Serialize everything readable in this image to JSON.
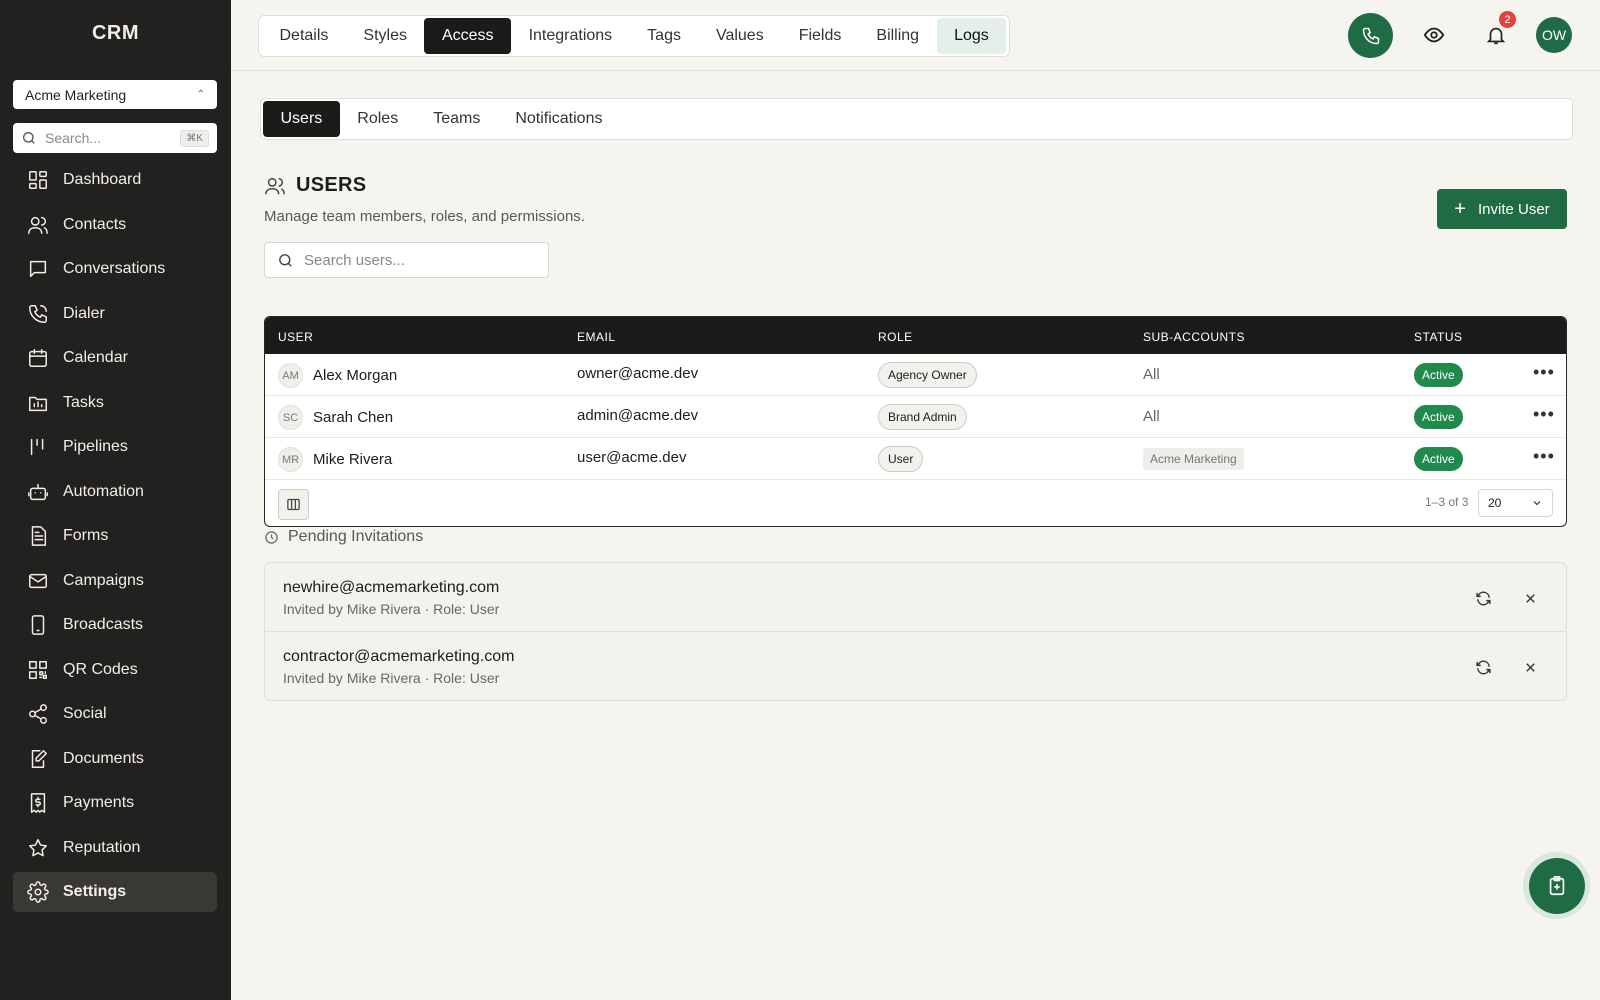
{
  "app": {
    "brand": "CRM"
  },
  "sidebar": {
    "account": "Acme Marketing",
    "search_placeholder": "Search...",
    "search_shortcut": "⌘K",
    "items": [
      {
        "label": "Dashboard",
        "icon": "dashboard-icon"
      },
      {
        "label": "Contacts",
        "icon": "contacts-icon"
      },
      {
        "label": "Conversations",
        "icon": "chat-icon"
      },
      {
        "label": "Dialer",
        "icon": "phone-icon"
      },
      {
        "label": "Calendar",
        "icon": "calendar-icon"
      },
      {
        "label": "Tasks",
        "icon": "tasks-icon"
      },
      {
        "label": "Pipelines",
        "icon": "pipelines-icon"
      },
      {
        "label": "Automation",
        "icon": "robot-icon"
      },
      {
        "label": "Forms",
        "icon": "form-icon"
      },
      {
        "label": "Campaigns",
        "icon": "mail-icon"
      },
      {
        "label": "Broadcasts",
        "icon": "mobile-icon"
      },
      {
        "label": "QR Codes",
        "icon": "qr-icon"
      },
      {
        "label": "Social",
        "icon": "share-icon"
      },
      {
        "label": "Documents",
        "icon": "document-edit-icon"
      },
      {
        "label": "Payments",
        "icon": "dollar-receipt-icon"
      },
      {
        "label": "Reputation",
        "icon": "star-icon"
      },
      {
        "label": "Settings",
        "icon": "gear-icon",
        "active": true
      }
    ]
  },
  "topbar": {
    "tabs": [
      {
        "label": "Details"
      },
      {
        "label": "Styles"
      },
      {
        "label": "Access",
        "active": true
      },
      {
        "label": "Integrations"
      },
      {
        "label": "Tags"
      },
      {
        "label": "Values"
      },
      {
        "label": "Fields"
      },
      {
        "label": "Billing"
      },
      {
        "label": "Logs",
        "soft": true
      }
    ],
    "notification_count": "2",
    "avatar_initials": "OW",
    "accent": "#1f6b44"
  },
  "subtabs": [
    {
      "label": "Users",
      "active": true
    },
    {
      "label": "Roles"
    },
    {
      "label": "Teams"
    },
    {
      "label": "Notifications"
    }
  ],
  "users": {
    "title": "USERS",
    "subtitle": "Manage team members, roles, and permissions.",
    "invite_label": "Invite User",
    "search_placeholder": "Search users...",
    "columns": [
      "USER",
      "EMAIL",
      "ROLE",
      "SUB-ACCOUNTS",
      "STATUS"
    ],
    "rows": [
      {
        "initials": "AM",
        "name": "Alex Morgan",
        "email": "owner@acme.dev",
        "role": "Agency Owner",
        "sub_accounts": "All",
        "sub_tag": false,
        "status": "Active"
      },
      {
        "initials": "SC",
        "name": "Sarah Chen",
        "email": "admin@acme.dev",
        "role": "Brand Admin",
        "sub_accounts": "All",
        "sub_tag": false,
        "status": "Active"
      },
      {
        "initials": "MR",
        "name": "Mike Rivera",
        "email": "user@acme.dev",
        "role": "User",
        "sub_accounts": "Acme Marketing",
        "sub_tag": true,
        "status": "Active"
      }
    ],
    "page_info": "1–3 of 3",
    "page_size": "20"
  },
  "pending": {
    "title": "Pending Invitations",
    "items": [
      {
        "email": "newhire@acmemarketing.com",
        "meta": "Invited by Mike Rivera · Role: User"
      },
      {
        "email": "contractor@acmemarketing.com",
        "meta": "Invited by Mike Rivera · Role: User"
      }
    ]
  }
}
